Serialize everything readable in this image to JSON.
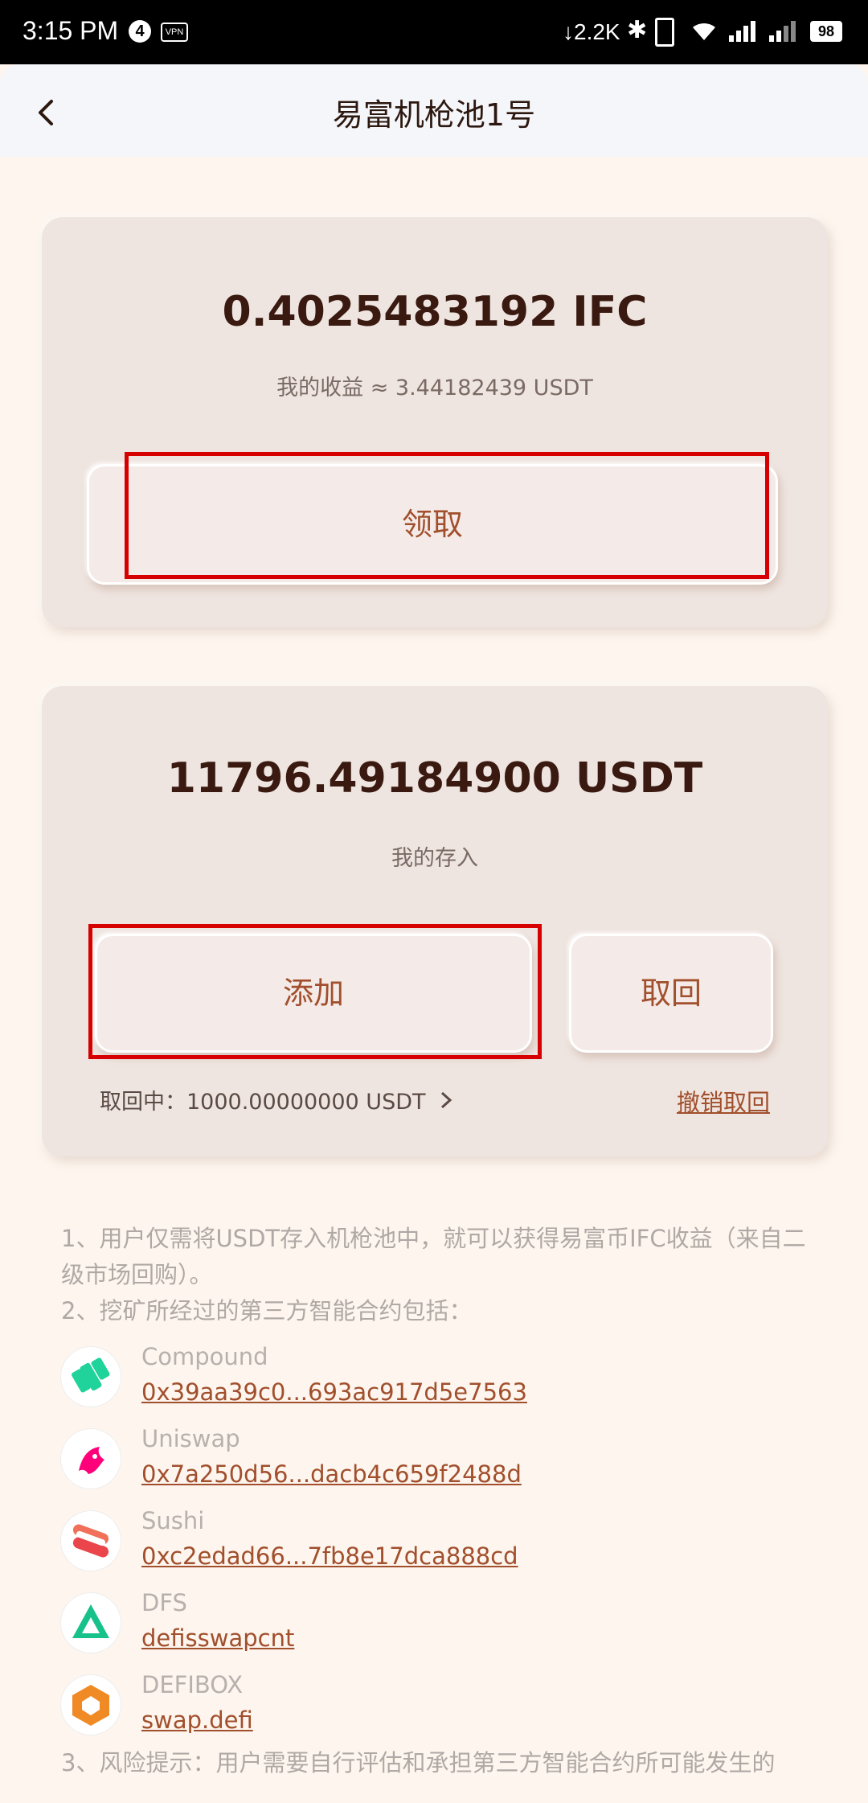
{
  "status_bar": {
    "time": "3:15 PM",
    "notif_count": "4",
    "vpn": "VPN",
    "net_speed": "↓2.2K",
    "battery": "98"
  },
  "header": {
    "title": "易富机枪池1号"
  },
  "earnings_card": {
    "amount": "0.4025483192 IFC",
    "subtitle": "我的收益 ≈ 3.44182439 USDT",
    "claim_label": "领取"
  },
  "deposit_card": {
    "amount": "11796.49184900 USDT",
    "subtitle": "我的存入",
    "add_label": "添加",
    "withdraw_label": "取回",
    "withdrawing": "取回中：1000.00000000 USDT",
    "cancel_withdraw": "撤销取回"
  },
  "notes": {
    "line1": "1、用户仅需将USDT存入机枪池中，就可以获得易富币IFC收益（来自二级市场回购）。",
    "line2": "2、挖矿所经过的第三方智能合约包括：",
    "line3": "3、风险提示：用户需要自行评估和承担第三方智能合约所可能发生的"
  },
  "contracts": [
    {
      "name": "Compound",
      "address": "0x39aa39c0...693ac917d5e7563",
      "icon": "compound-icon"
    },
    {
      "name": "Uniswap",
      "address": "0x7a250d56...dacb4c659f2488d",
      "icon": "uniswap-icon"
    },
    {
      "name": "Sushi",
      "address": "0xc2edad66...7fb8e17dca888cd",
      "icon": "sushi-icon"
    },
    {
      "name": "DFS",
      "address": "defisswapcnt",
      "icon": "dfs-icon"
    },
    {
      "name": "DEFIBOX",
      "address": "swap.defi",
      "icon": "defibox-icon"
    }
  ],
  "colors": {
    "accent": "#a14f2c",
    "highlight_box": "#d60000",
    "background": "#fdf5ee"
  }
}
